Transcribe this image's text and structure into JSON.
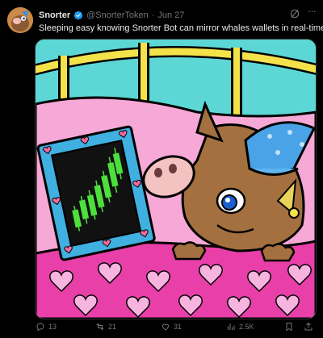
{
  "tweet": {
    "author_name": "Snorter",
    "handle": "@SnorterToken",
    "separator": "·",
    "date": "Jun 27",
    "text": "Sleeping easy knowing Snorter Bot can mirror whales wallets in real-time.",
    "more_label": "···"
  },
  "actions": {
    "replies": "13",
    "reposts": "21",
    "likes": "31",
    "views": "2.5K"
  },
  "colors": {
    "background": "#000000",
    "text_primary": "#e7e9ea",
    "text_secondary": "#71767b",
    "verified": "#1d9bf0"
  }
}
